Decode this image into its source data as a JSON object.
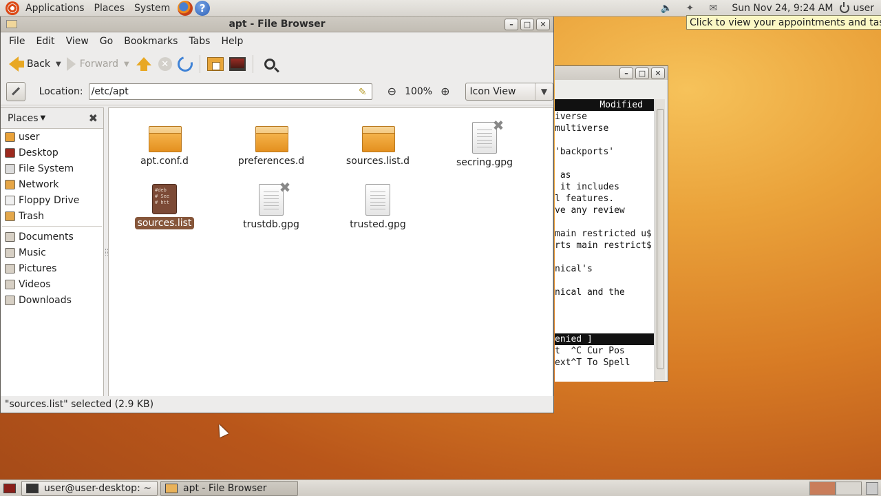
{
  "top_panel": {
    "menus": [
      "Applications",
      "Places",
      "System"
    ],
    "clock": "Sun Nov 24,  9:24 AM",
    "user": "user"
  },
  "tooltip": "Click to view your appointments and tasks",
  "terminal": {
    "status": "Modified",
    "lines": [
      "",
      "iverse",
      "multiverse",
      "",
      "'backports'",
      "",
      " as",
      " it includes",
      "l features.",
      "ve any review",
      "",
      "main restricted u$",
      "rts main restrict$",
      "",
      "nical's",
      "",
      "nical and the",
      "",
      "",
      "",
      "enied ]",
      "t  ^C Cur Pos",
      "ext^T To Spell"
    ]
  },
  "file_browser": {
    "title": "apt - File Browser",
    "menus": [
      "File",
      "Edit",
      "View",
      "Go",
      "Bookmarks",
      "Tabs",
      "Help"
    ],
    "toolbar": {
      "back": "Back",
      "forward": "Forward"
    },
    "location": {
      "label": "Location:",
      "value": "/etc/apt"
    },
    "zoom": "100%",
    "view_mode": "Icon View",
    "sidebar": {
      "header": "Places",
      "places": [
        "user",
        "Desktop",
        "File System",
        "Network",
        "Floppy Drive",
        "Trash"
      ],
      "bookmarks": [
        "Documents",
        "Music",
        "Pictures",
        "Videos",
        "Downloads"
      ]
    },
    "files": [
      {
        "name": "apt.conf.d",
        "kind": "folder"
      },
      {
        "name": "preferences.d",
        "kind": "folder"
      },
      {
        "name": "sources.list.d",
        "kind": "folder"
      },
      {
        "name": "secring.gpg",
        "kind": "doc-locked"
      },
      {
        "name": "sources.list",
        "kind": "text-selected"
      },
      {
        "name": "trustdb.gpg",
        "kind": "doc-locked"
      },
      {
        "name": "trusted.gpg",
        "kind": "doc"
      }
    ],
    "sources_preview": "#deb\n# See\n# htt",
    "status": "\"sources.list\" selected (2.9 KB)"
  },
  "taskbar": {
    "tasks": [
      "user@user-desktop: ~",
      "apt - File Browser"
    ]
  }
}
